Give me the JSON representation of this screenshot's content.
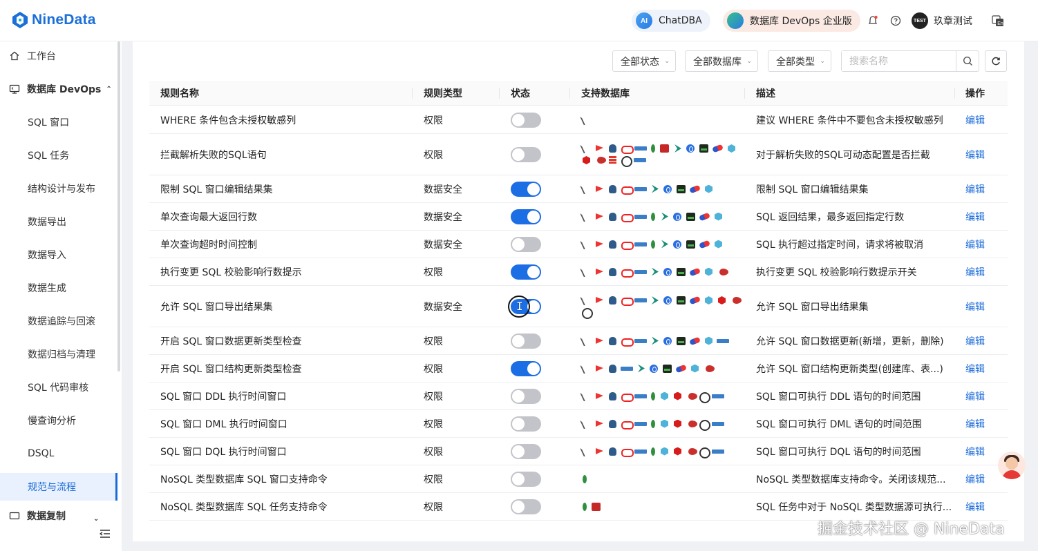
{
  "header": {
    "logo_text": "NineData",
    "chat_label": "ChatDBA",
    "chat_badge": "AI",
    "edition_label": "数据库 DevOps 企业版",
    "user_badge": "TEST",
    "user_name": "玖章测试",
    "icons": [
      "bell-icon",
      "help-icon",
      "language-icon"
    ]
  },
  "sidebar": {
    "top_items": [
      {
        "label": "工作台",
        "icon": "home-icon"
      },
      {
        "label": "数据库 DevOps",
        "icon": "monitor-icon",
        "expanded": true
      }
    ],
    "sub_items": [
      {
        "label": "SQL 窗口"
      },
      {
        "label": "SQL 任务"
      },
      {
        "label": "结构设计与发布"
      },
      {
        "label": "数据导出"
      },
      {
        "label": "数据导入"
      },
      {
        "label": "数据生成"
      },
      {
        "label": "数据追踪与回滚"
      },
      {
        "label": "数据归档与清理"
      },
      {
        "label": "SQL 代码审核"
      },
      {
        "label": "慢查询分析"
      },
      {
        "label": "DSQL"
      },
      {
        "label": "规范与流程",
        "active": true
      }
    ],
    "partial_item": {
      "label": "数据复制",
      "icon": "monitor-icon"
    }
  },
  "filters": {
    "status": "全部状态",
    "database": "全部数据库",
    "type": "全部类型",
    "search_placeholder": "搜索名称"
  },
  "table": {
    "headers": {
      "name": "规则名称",
      "type": "规则类型",
      "status": "状态",
      "dbs": "支持数据库",
      "desc": "描述",
      "action": "操作"
    },
    "rows": [
      {
        "name": "WHERE 条件包含未授权敏感列",
        "type": "权限",
        "on": false,
        "dbs": [
          "tri"
        ],
        "desc": "建议 WHERE 条件中不要包含未授权敏感列",
        "action": "编辑"
      },
      {
        "name": "拦截解析失败的SQL语句",
        "type": "权限",
        "on": false,
        "dbs": [
          "tri",
          "flag",
          "pg",
          "ora",
          "ms",
          "mongo",
          "redis",
          "rocket",
          "swirl",
          "term",
          "pill2",
          "cube",
          "hex",
          "swan",
          "stack",
          "graph",
          "ms"
        ],
        "desc": "对于解析失败的SQL可动态配置是否拦截",
        "action": "编辑"
      },
      {
        "name": "限制 SQL 窗口编辑结果集",
        "type": "数据安全",
        "on": true,
        "dbs": [
          "tri",
          "flag",
          "pg",
          "ora",
          "ms",
          "rocket",
          "swirl",
          "term",
          "pill2",
          "cube"
        ],
        "desc": "限制 SQL 窗口编辑结果集",
        "action": "编辑"
      },
      {
        "name": "单次查询最大返回行数",
        "type": "数据安全",
        "on": true,
        "dbs": [
          "tri",
          "flag",
          "pg",
          "ora",
          "ms",
          "mongo",
          "rocket",
          "swirl",
          "term",
          "pill2",
          "cube"
        ],
        "desc": "SQL 返回结果，最多返回指定行数",
        "action": "编辑"
      },
      {
        "name": "单次查询超时时间控制",
        "type": "数据安全",
        "on": false,
        "dbs": [
          "tri",
          "flag",
          "pg",
          "ora",
          "ms",
          "mongo",
          "rocket",
          "swirl",
          "term",
          "pill2",
          "cube"
        ],
        "desc": "SQL 执行超过指定时间，请求将被取消",
        "action": "编辑"
      },
      {
        "name": "执行变更 SQL 校验影响行数提示",
        "type": "权限",
        "on": true,
        "dbs": [
          "tri",
          "flag",
          "pg",
          "ora",
          "ms",
          "rocket",
          "swirl",
          "term",
          "pill2",
          "cube",
          "swan"
        ],
        "desc": "执行变更 SQL 校验影响行数提示开关",
        "action": "编辑"
      },
      {
        "name": "允许 SQL 窗口导出结果集",
        "type": "数据安全",
        "on": true,
        "cursor": true,
        "dbs": [
          "tri",
          "flag",
          "pg",
          "ora",
          "ms",
          "rocket",
          "swirl",
          "term",
          "pill2",
          "cube",
          "hex",
          "swan",
          "graph"
        ],
        "desc": "允许 SQL 窗口导出结果集",
        "action": "编辑"
      },
      {
        "name": "开启 SQL 窗口数据更新类型检查",
        "type": "权限",
        "on": false,
        "dbs": [
          "tri",
          "flag",
          "pg",
          "ora",
          "ms",
          "rocket",
          "swirl",
          "term",
          "pill2",
          "cube",
          "ms"
        ],
        "desc": "允许 SQL 窗口数据更新(新增，更新，删除)",
        "action": "编辑"
      },
      {
        "name": "开启 SQL 窗口结构更新类型检查",
        "type": "权限",
        "on": true,
        "dbs": [
          "tri",
          "flag",
          "pg",
          "ms",
          "rocket",
          "swirl",
          "term",
          "pill2",
          "cube",
          "swan"
        ],
        "desc": "允许 SQL 窗口结构更新类型(创建库、表...)",
        "action": "编辑"
      },
      {
        "name": "SQL 窗口 DDL 执行时间窗口",
        "type": "权限",
        "on": false,
        "dbs": [
          "tri",
          "flag",
          "pg",
          "ora",
          "ms",
          "mongo",
          "cube",
          "hex",
          "swan",
          "graph",
          "ms"
        ],
        "desc": "SQL 窗口可执行 DDL 语句的时间范围",
        "action": "编辑"
      },
      {
        "name": "SQL 窗口 DML 执行时间窗口",
        "type": "权限",
        "on": false,
        "dbs": [
          "tri",
          "flag",
          "pg",
          "ora",
          "ms",
          "mongo",
          "cube",
          "hex",
          "swan",
          "graph",
          "ms"
        ],
        "desc": "SQL 窗口可执行 DML 语句的时间范围",
        "action": "编辑"
      },
      {
        "name": "SQL 窗口 DQL 执行时间窗口",
        "type": "权限",
        "on": false,
        "dbs": [
          "tri",
          "flag",
          "pg",
          "ora",
          "ms",
          "mongo",
          "cube",
          "hex",
          "swan",
          "graph",
          "ms"
        ],
        "desc": "SQL 窗口可执行 DQL 语句的时间范围",
        "action": "编辑"
      },
      {
        "name": "NoSQL 类型数据库 SQL 窗口支持命令",
        "type": "权限",
        "on": false,
        "dbs": [
          "mongo"
        ],
        "desc": "NoSQL 类型数据库支持命令。关闭该规范...",
        "action": "编辑"
      },
      {
        "name": "NoSQL 类型数据库 SQL 任务支持命令",
        "type": "权限",
        "on": false,
        "dbs": [
          "mongo",
          "redis"
        ],
        "desc": "SQL 任务中对于 NoSQL 类型数据源可执行...",
        "action": "编辑"
      }
    ]
  },
  "watermark": "掘金技术社区 @ NineData",
  "colors": {
    "accent": "#1a6bd9",
    "toggle_on": "#1c6ee5",
    "toggle_off": "#c2c4c9"
  }
}
